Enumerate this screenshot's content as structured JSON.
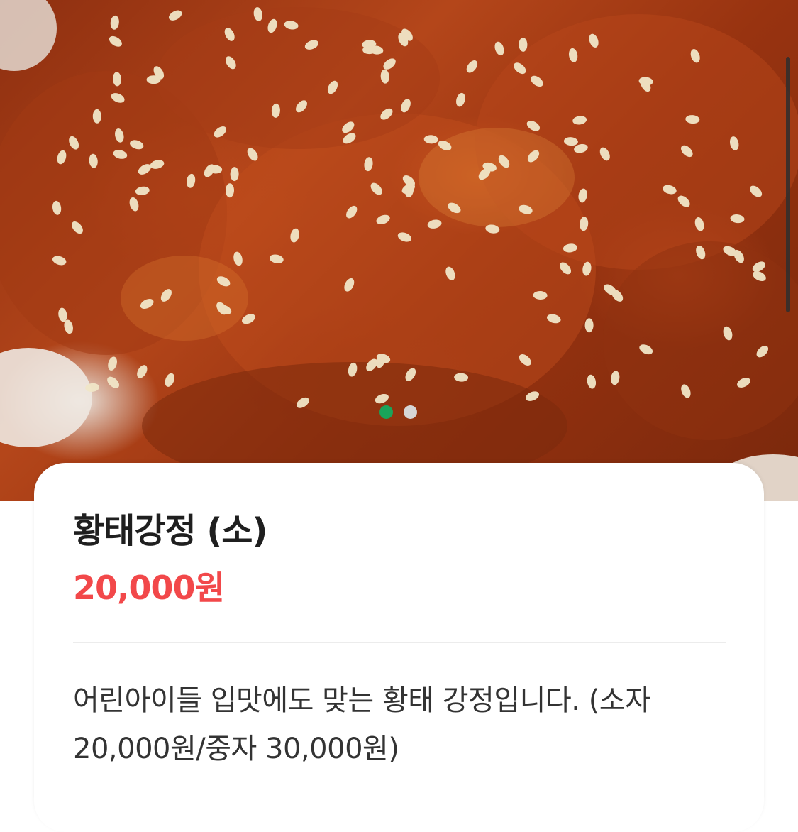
{
  "menu_item": {
    "title": "황태강정 (소)",
    "price": "20,000원",
    "description": "어린아이들 입맛에도 맞는 황태 강정입니다. (소자 20,000원/중자 30,000원)"
  },
  "carousel": {
    "total": 2,
    "current": 1,
    "active_color": "#1aa45a",
    "inactive_color": "#d6d6d6"
  },
  "colors": {
    "price": "#f2484a",
    "title": "#1f1f1f"
  }
}
